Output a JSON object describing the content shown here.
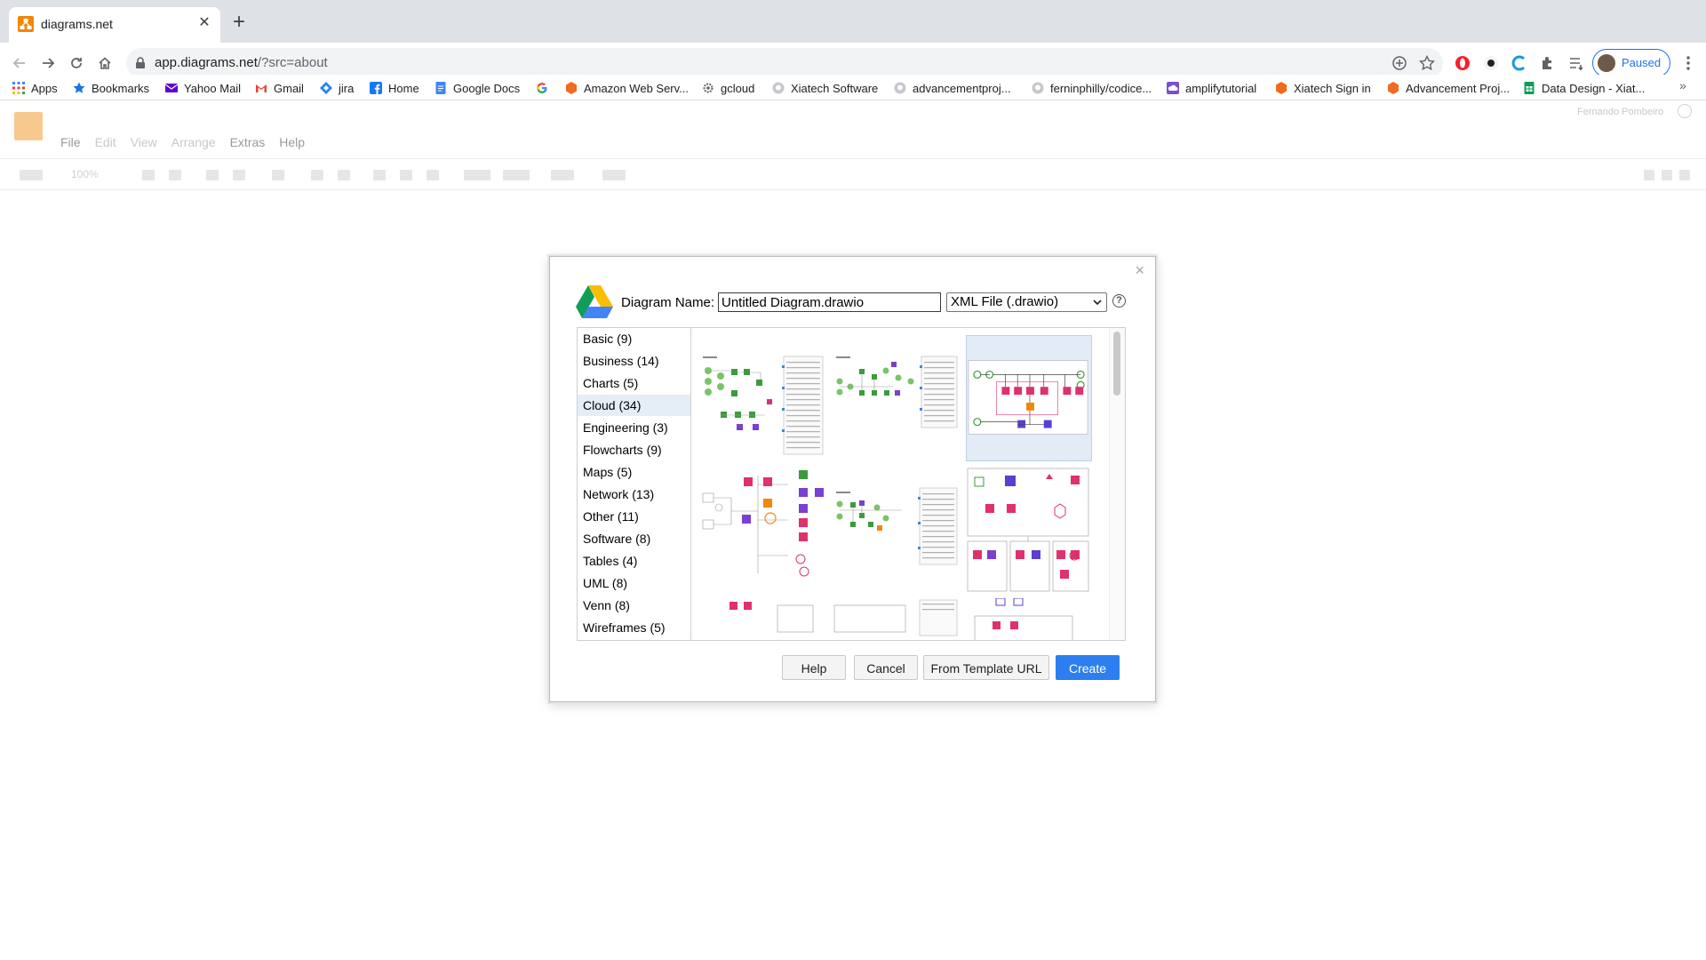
{
  "browser": {
    "tab": {
      "title": "diagrams.net",
      "close_symbol": "✕"
    },
    "new_tab_symbol": "+",
    "url": {
      "host": "app.diagrams.net",
      "path": "/?src=about"
    },
    "profile": {
      "label": "Paused"
    },
    "bookmarks": [
      {
        "label": "Apps",
        "icon": "apps-grid-icon",
        "color": "#4285f4"
      },
      {
        "label": "Bookmarks",
        "icon": "star-icon",
        "color": "#1a73e8"
      },
      {
        "label": "Yahoo Mail",
        "icon": "mail-icon",
        "color": "#6001d2"
      },
      {
        "label": "Gmail",
        "icon": "gmail-icon",
        "color": "#ea4335"
      },
      {
        "label": "jira",
        "icon": "jira-icon",
        "color": "#2684ff"
      },
      {
        "label": "Home",
        "icon": "facebook-icon",
        "color": "#1877f2"
      },
      {
        "label": "Google Docs",
        "icon": "docs-icon",
        "color": "#4285f4"
      },
      {
        "label": "",
        "icon": "google-icon",
        "color": "#ea4335"
      },
      {
        "label": "Amazon Web Serv...",
        "icon": "aws-icon",
        "color": "#ff9900"
      },
      {
        "label": "gcloud",
        "icon": "gear-icon",
        "color": "#5f6368"
      },
      {
        "label": "Xiatech Software",
        "icon": "github-icon",
        "color": "#9aa0a6"
      },
      {
        "label": "advancementproj...",
        "icon": "github-icon",
        "color": "#9aa0a6"
      },
      {
        "label": "ferninphilly/codice...",
        "icon": "github-icon",
        "color": "#9aa0a6"
      },
      {
        "label": "amplifytutorial",
        "icon": "cloud-icon",
        "color": "#7b4fc9"
      },
      {
        "label": "Xiatech Sign in",
        "icon": "aws-icon",
        "color": "#ff9900"
      },
      {
        "label": "Advancement Proj...",
        "icon": "aws-icon",
        "color": "#ff9900"
      },
      {
        "label": "Data Design - Xiat...",
        "icon": "sheets-icon",
        "color": "#0f9d58"
      }
    ],
    "bookmarks_more": "»"
  },
  "app": {
    "menus": [
      {
        "label": "File",
        "enabled": true
      },
      {
        "label": "Edit",
        "enabled": false
      },
      {
        "label": "View",
        "enabled": false
      },
      {
        "label": "Arrange",
        "enabled": false
      },
      {
        "label": "Extras",
        "enabled": true
      },
      {
        "label": "Help",
        "enabled": true
      }
    ],
    "user": "Fernando Pombeiro",
    "zoom": "100%"
  },
  "dialog": {
    "close_symbol": "×",
    "name_label": "Diagram Name:",
    "name_value": "Untitled Diagram.drawio",
    "format_selected": "XML File (.drawio)",
    "help_symbol": "?",
    "categories": [
      {
        "label": "Basic (9)",
        "selected": false
      },
      {
        "label": "Business (14)",
        "selected": false
      },
      {
        "label": "Charts (5)",
        "selected": false
      },
      {
        "label": "Cloud (34)",
        "selected": true
      },
      {
        "label": "Engineering (3)",
        "selected": false
      },
      {
        "label": "Flowcharts (9)",
        "selected": false
      },
      {
        "label": "Maps (5)",
        "selected": false
      },
      {
        "label": "Network (13)",
        "selected": false
      },
      {
        "label": "Other (11)",
        "selected": false
      },
      {
        "label": "Software (8)",
        "selected": false
      },
      {
        "label": "Tables (4)",
        "selected": false
      },
      {
        "label": "UML (8)",
        "selected": false
      },
      {
        "label": "Venn (8)",
        "selected": false
      },
      {
        "label": "Wireframes (5)",
        "selected": false
      }
    ],
    "buttons": {
      "help": "Help",
      "cancel": "Cancel",
      "from_url": "From Template URL",
      "create": "Create"
    },
    "colors": {
      "primary": "#2d7ff0",
      "selection": "#e5edf7"
    }
  }
}
